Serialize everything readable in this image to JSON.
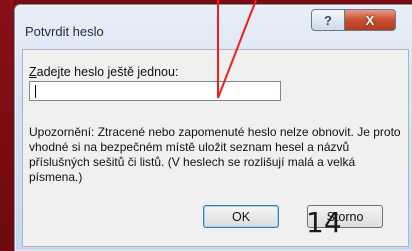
{
  "dialog": {
    "title": "Potvrdit heslo",
    "help_label": "?",
    "close_label": "X",
    "prompt_accesskey": "Z",
    "prompt_rest": "adejte heslo ještě jednou:",
    "password_value": "",
    "warning_text": "Upozornění: Ztracené nebo zapomenuté heslo nelze obnovit. Je proto vhodné si na bezpečném místě uložit seznam hesel a názvů příslušných sešitů či listů. (V heslech se rozlišují malá a velká písmena.)",
    "ok_label": "OK",
    "cancel_label": "Storno"
  },
  "slide": {
    "page_number": "14"
  },
  "colors": {
    "background": "#7a0b12",
    "callout": "#ff1a1a",
    "close_button": "#c94f31"
  }
}
